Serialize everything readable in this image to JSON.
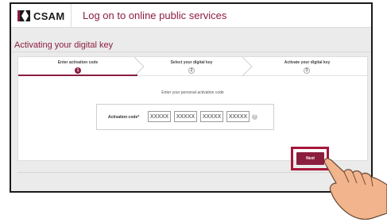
{
  "header": {
    "logo_text": "CSAM",
    "title": "Log on to online public services"
  },
  "page": {
    "title": "Activating your digital key"
  },
  "steps": [
    {
      "label": "Enter activation code",
      "number": "1",
      "state": "active"
    },
    {
      "label": "Select your digital key",
      "number": "2",
      "state": "inactive"
    },
    {
      "label": "Activate your digital key",
      "number": "3",
      "state": "inactive"
    }
  ],
  "form": {
    "instruction": "Enter your personal activation code",
    "code_label": "Activation code*",
    "fields": [
      {
        "placeholder": "XXXXX"
      },
      {
        "placeholder": "XXXXX"
      },
      {
        "placeholder": "XXXXX"
      },
      {
        "placeholder": "XXXXX"
      }
    ],
    "help_icon": "?"
  },
  "actions": {
    "next_label": "Next"
  },
  "colors": {
    "brand": "#8b1e3f",
    "highlight": "#a8163a",
    "background": "#ebebeb",
    "skin": "#f2b48c"
  },
  "icons": {
    "logo": "csam-logo-icon",
    "help": "help-icon",
    "pointer": "pointing-hand-icon"
  }
}
